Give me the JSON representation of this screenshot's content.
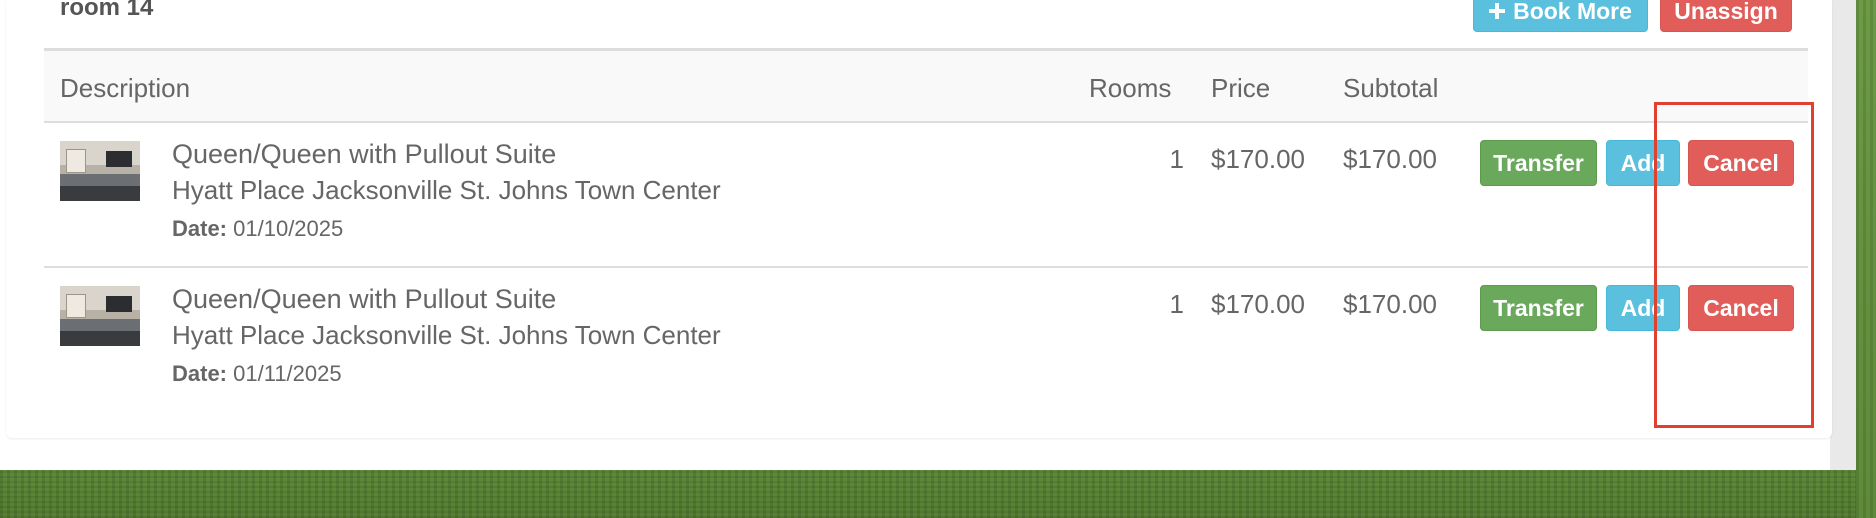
{
  "room": {
    "title": "room 14"
  },
  "actions": {
    "book_more_label": "Book More",
    "unassign_label": "Unassign"
  },
  "table": {
    "columns": {
      "description": "Description",
      "rooms": "Rooms",
      "price": "Price",
      "subtotal": "Subtotal"
    },
    "rows": [
      {
        "title": "Queen/Queen with Pullout Suite",
        "hotel": "Hyatt Place Jacksonville St. Johns Town Center",
        "date_label": "Date:",
        "date": "01/10/2025",
        "rooms": "1",
        "price": "$170.00",
        "subtotal": "$170.00",
        "transfer_label": "Transfer",
        "add_label": "Add",
        "cancel_label": "Cancel"
      },
      {
        "title": "Queen/Queen with Pullout Suite",
        "hotel": "Hyatt Place Jacksonville St. Johns Town Center",
        "date_label": "Date:",
        "date": "01/11/2025",
        "rooms": "1",
        "price": "$170.00",
        "subtotal": "$170.00",
        "transfer_label": "Transfer",
        "add_label": "Add",
        "cancel_label": "Cancel"
      }
    ]
  },
  "colors": {
    "info": "#5bc0de",
    "danger": "#e05d5a",
    "success": "#6aa85c",
    "highlight": "#e0412e",
    "text": "#666666"
  },
  "icons": {
    "book_more": "plus-icon",
    "room_thumbnail": "room-photo"
  }
}
